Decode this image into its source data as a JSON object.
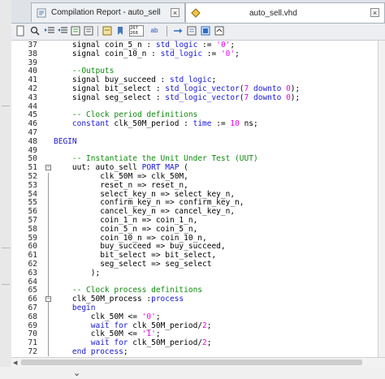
{
  "tabs": [
    {
      "label": "Compilation Report - auto_sell",
      "active": false
    },
    {
      "label": "auto_sell.vhd",
      "active": true
    }
  ],
  "colors": {
    "keyword": "#1717d8",
    "string": "#ee00ee",
    "number": "#ee00ee",
    "comment": "#0c8a0c"
  },
  "toolbar": {
    "icons": [
      "file-icon",
      "find-icon",
      "indent-icon",
      "outdent-icon",
      "comment-icon",
      "uncomment-icon",
      "insert-template-icon",
      "toggle-bookmark-icon",
      "line-number-icon",
      "spell-check-icon",
      "go-to-line-icon",
      "previous-bookmark-icon",
      "next-bookmark-icon",
      "expand-icon"
    ],
    "line_number_label": "267\n268",
    "spell_label": "ab"
  },
  "editor": {
    "lines": [
      {
        "n": "37",
        "fold": "",
        "tokens": [
          [
            "pl",
            "    signal coin_5_n : "
          ],
          [
            "kw",
            "std_logic"
          ],
          [
            "pl",
            " := "
          ],
          [
            "str",
            "'0'"
          ],
          [
            "pl",
            ";"
          ]
        ]
      },
      {
        "n": "38",
        "fold": "",
        "tokens": [
          [
            "pl",
            "    signal coin_10_n : "
          ],
          [
            "kw",
            "std_logic"
          ],
          [
            "pl",
            " := "
          ],
          [
            "str",
            "'0'"
          ],
          [
            "pl",
            ";"
          ]
        ]
      },
      {
        "n": "39",
        "fold": "",
        "tokens": []
      },
      {
        "n": "40",
        "fold": "",
        "tokens": [
          [
            "cm",
            "    --Outputs"
          ]
        ]
      },
      {
        "n": "41",
        "fold": "",
        "tokens": [
          [
            "pl",
            "    signal buy_succeed : "
          ],
          [
            "kw",
            "std_logic"
          ],
          [
            "pl",
            ";"
          ]
        ]
      },
      {
        "n": "42",
        "fold": "",
        "tokens": [
          [
            "pl",
            "    signal bit_select : "
          ],
          [
            "kw",
            "std_logic_vector"
          ],
          [
            "pl",
            "("
          ],
          [
            "num",
            "7"
          ],
          [
            "pl",
            " "
          ],
          [
            "kw",
            "downto"
          ],
          [
            "pl",
            " "
          ],
          [
            "num",
            "0"
          ],
          [
            "pl",
            ");"
          ]
        ]
      },
      {
        "n": "43",
        "fold": "",
        "tokens": [
          [
            "pl",
            "    signal seg_select : "
          ],
          [
            "kw",
            "std_logic_vector"
          ],
          [
            "pl",
            "("
          ],
          [
            "num",
            "7"
          ],
          [
            "pl",
            " "
          ],
          [
            "kw",
            "downto"
          ],
          [
            "pl",
            " "
          ],
          [
            "num",
            "0"
          ],
          [
            "pl",
            ");"
          ]
        ]
      },
      {
        "n": "44",
        "fold": "",
        "tokens": []
      },
      {
        "n": "45",
        "fold": "",
        "tokens": [
          [
            "cm",
            "    -- Clock period definitions"
          ]
        ]
      },
      {
        "n": "46",
        "fold": "",
        "tokens": [
          [
            "pl",
            "    "
          ],
          [
            "kw",
            "constant"
          ],
          [
            "pl",
            " clk_50M_period : "
          ],
          [
            "kw",
            "time"
          ],
          [
            "pl",
            " := "
          ],
          [
            "num",
            "10"
          ],
          [
            "pl",
            " ns;"
          ]
        ]
      },
      {
        "n": "47",
        "fold": "",
        "tokens": []
      },
      {
        "n": "48",
        "fold": "",
        "tokens": [
          [
            "kw",
            "BEGIN"
          ]
        ]
      },
      {
        "n": "49",
        "fold": "",
        "tokens": []
      },
      {
        "n": "50",
        "fold": "",
        "tokens": [
          [
            "cm",
            "    -- Instantiate the Unit Under Test (UUT)"
          ]
        ]
      },
      {
        "n": "51",
        "fold": "minus",
        "tokens": [
          [
            "pl",
            "    uut: auto_sell "
          ],
          [
            "kw",
            "PORT MAP"
          ],
          [
            "pl",
            " ("
          ]
        ]
      },
      {
        "n": "52",
        "fold": "",
        "tokens": [
          [
            "pl",
            "          clk_50M => clk_50M,"
          ]
        ]
      },
      {
        "n": "53",
        "fold": "",
        "tokens": [
          [
            "pl",
            "          reset_n => reset_n,"
          ]
        ]
      },
      {
        "n": "54",
        "fold": "",
        "tokens": [
          [
            "pl",
            "          select_key_n => select_key_n,"
          ]
        ]
      },
      {
        "n": "55",
        "fold": "",
        "tokens": [
          [
            "pl",
            "          confirm_key_n => confirm_key_n,"
          ]
        ]
      },
      {
        "n": "56",
        "fold": "",
        "tokens": [
          [
            "pl",
            "          cancel_key_n => cancel_key_n,"
          ]
        ]
      },
      {
        "n": "57",
        "fold": "",
        "tokens": [
          [
            "pl",
            "          coin_1_n => coin_1_n,"
          ]
        ]
      },
      {
        "n": "58",
        "fold": "",
        "tokens": [
          [
            "pl",
            "          coin_5_n => coin_5_n,"
          ]
        ]
      },
      {
        "n": "59",
        "fold": "",
        "tokens": [
          [
            "pl",
            "          coin_10_n => coin_10_n,"
          ]
        ]
      },
      {
        "n": "60",
        "fold": "",
        "tokens": [
          [
            "pl",
            "          buy_succeed => buy_succeed,"
          ]
        ]
      },
      {
        "n": "61",
        "fold": "",
        "tokens": [
          [
            "pl",
            "          bit_select => bit_select,"
          ]
        ]
      },
      {
        "n": "62",
        "fold": "",
        "tokens": [
          [
            "pl",
            "          seg_select => seg_select"
          ]
        ]
      },
      {
        "n": "63",
        "fold": "",
        "tokens": [
          [
            "pl",
            "        );"
          ]
        ]
      },
      {
        "n": "64",
        "fold": "",
        "tokens": []
      },
      {
        "n": "65",
        "fold": "",
        "tokens": [
          [
            "cm",
            "    -- Clock process definitions"
          ]
        ]
      },
      {
        "n": "66",
        "fold": "minus",
        "tokens": [
          [
            "pl",
            "    clk_50M_process :"
          ],
          [
            "kw",
            "process"
          ]
        ]
      },
      {
        "n": "67",
        "fold": "",
        "tokens": [
          [
            "pl",
            "    "
          ],
          [
            "kw",
            "begin"
          ]
        ]
      },
      {
        "n": "68",
        "fold": "",
        "tokens": [
          [
            "pl",
            "        clk_50M <= "
          ],
          [
            "str",
            "'0'"
          ],
          [
            "pl",
            ";"
          ]
        ]
      },
      {
        "n": "69",
        "fold": "",
        "tokens": [
          [
            "pl",
            "        "
          ],
          [
            "kw",
            "wait for"
          ],
          [
            "pl",
            " clk_50M_period/"
          ],
          [
            "num",
            "2"
          ],
          [
            "pl",
            ";"
          ]
        ]
      },
      {
        "n": "70",
        "fold": "",
        "tokens": [
          [
            "pl",
            "        clk_50M <= "
          ],
          [
            "str",
            "'1'"
          ],
          [
            "pl",
            ";"
          ]
        ]
      },
      {
        "n": "71",
        "fold": "",
        "tokens": [
          [
            "pl",
            "        "
          ],
          [
            "kw",
            "wait for"
          ],
          [
            "pl",
            " clk_50M_period/"
          ],
          [
            "num",
            "2"
          ],
          [
            "pl",
            ";"
          ]
        ]
      },
      {
        "n": "72",
        "fold": "",
        "tokens": [
          [
            "pl",
            "    "
          ],
          [
            "kw",
            "end process"
          ],
          [
            "pl",
            ";"
          ]
        ]
      }
    ]
  }
}
